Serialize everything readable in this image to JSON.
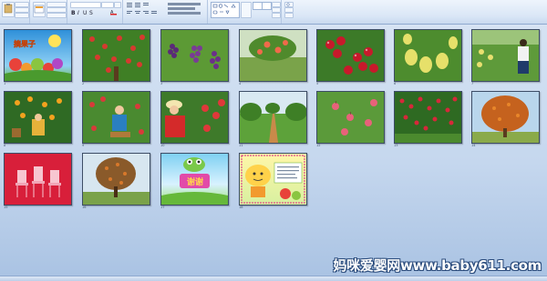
{
  "ribbon": {
    "groups": [
      {
        "name": "clipboard",
        "label": ""
      },
      {
        "name": "slides",
        "label": ""
      },
      {
        "name": "font",
        "label": ""
      },
      {
        "name": "paragraph",
        "label": ""
      },
      {
        "name": "drawing",
        "label": ""
      },
      {
        "name": "editing",
        "label": ""
      }
    ]
  },
  "slides": [
    {
      "n": "1",
      "kind": "title"
    },
    {
      "n": "2",
      "kind": "apple-tree"
    },
    {
      "n": "3",
      "kind": "grapes"
    },
    {
      "n": "4",
      "kind": "peach"
    },
    {
      "n": "5",
      "kind": "red-apples"
    },
    {
      "n": "6",
      "kind": "pears"
    },
    {
      "n": "7",
      "kind": "picker"
    },
    {
      "n": "8",
      "kind": "orange-tree"
    },
    {
      "n": "9",
      "kind": "picker-2"
    },
    {
      "n": "10",
      "kind": "woman-picking"
    },
    {
      "n": "11",
      "kind": "orchard-path"
    },
    {
      "n": "12",
      "kind": "hanging-apples"
    },
    {
      "n": "13",
      "kind": "apple-orchard"
    },
    {
      "n": "14",
      "kind": "persimmon-tree"
    },
    {
      "n": "15",
      "kind": "red-chairs"
    },
    {
      "n": "16",
      "kind": "fruit-tree"
    },
    {
      "n": "17",
      "kind": "thanks"
    },
    {
      "n": "18",
      "kind": "cartoon"
    }
  ],
  "watermark": "妈咪爱婴网www.baby611.com",
  "colors": {
    "ribbon": "#d9e6f6",
    "background": "#c5d7ee",
    "accent": "#2a4b7c"
  }
}
